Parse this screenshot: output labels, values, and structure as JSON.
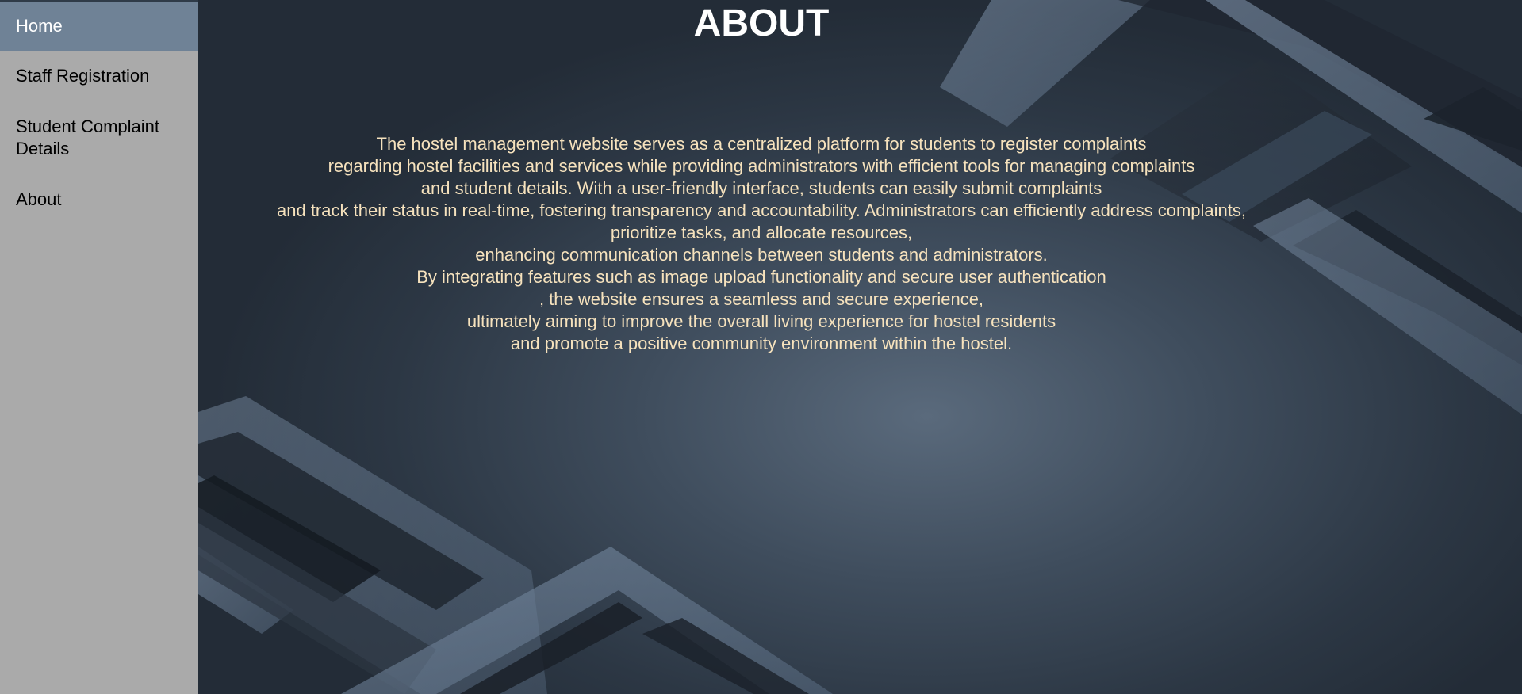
{
  "sidebar": {
    "items": [
      {
        "label": "Home",
        "active": true
      },
      {
        "label": "Staff Registration",
        "active": false
      },
      {
        "label": "Student Complaint Details",
        "active": false
      },
      {
        "label": "About",
        "active": false
      }
    ]
  },
  "main": {
    "title": "ABOUT",
    "lines": [
      "The hostel management website serves as a centralized platform for students to register complaints",
      "regarding hostel facilities and services while providing administrators with efficient tools for managing complaints",
      "and student details. With a user-friendly interface, students can easily submit complaints",
      "and track their status in real-time, fostering transparency and accountability. Administrators can efficiently address complaints,",
      "prioritize tasks, and allocate resources,",
      "enhancing communication channels between students and administrators.",
      "By integrating features such as image upload functionality and secure user authentication",
      ", the website ensures a seamless and secure experience,",
      "ultimately aiming to improve the overall living experience for hostel residents",
      "and promote a positive community environment within the hostel."
    ]
  },
  "colors": {
    "sidebar_bg": "#aaaaaa",
    "active_item_bg": "#6f8296",
    "title_color": "#ffffff",
    "text_color": "#f6e2bd",
    "background_dark": "#2c3744"
  }
}
